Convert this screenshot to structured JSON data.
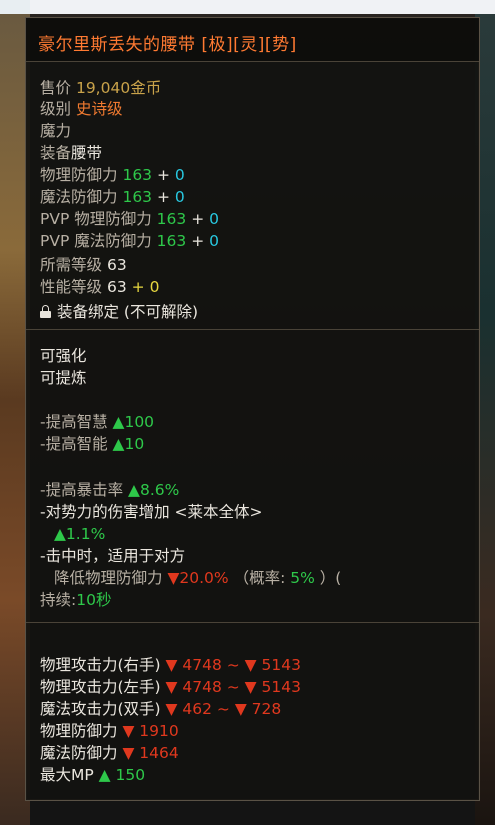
{
  "item": {
    "name": "豪尔里斯丢失的腰带 [极][灵][势]",
    "price_label": "售价",
    "price_value": "19,040金币",
    "grade_label": "级别",
    "grade_value": "史诗级",
    "type_label": "魔力",
    "equip_label": "装备",
    "equip_value": "腰带",
    "stats": [
      {
        "label": "物理防御力",
        "base": "163",
        "plus": "+",
        "bonus": "0"
      },
      {
        "label": "魔法防御力",
        "base": "163",
        "plus": "+",
        "bonus": "0"
      },
      {
        "label": "PVP 物理防御力",
        "base": "163",
        "plus": "+",
        "bonus": "0"
      },
      {
        "label": "PVP 魔法防御力",
        "base": "163",
        "plus": "+",
        "bonus": "0"
      }
    ],
    "req_level_label": "所需等级",
    "req_level_value": "63",
    "perf_level_label": "性能等级",
    "perf_level_value": "63",
    "perf_level_plus": "+",
    "perf_level_bonus": "0",
    "bind_text": "装备绑定 (不可解除)"
  },
  "flags": [
    "可强化",
    "可提炼"
  ],
  "bonuses": {
    "wisdom_label": "-提高智慧",
    "wisdom_value": "▲100",
    "intel_label": "-提高智能",
    "intel_value": "▲10",
    "crit_label": "-提高暴击率",
    "crit_value": "▲8.6%",
    "faction_label": "-对势力的伤害增加",
    "faction_target": "<莱本全体>",
    "faction_value": "▲1.1%",
    "onhit_label": "-击中时，适用于对方",
    "onhit_effect_label": "降低物理防御力",
    "onhit_effect_value": "▼20.0%",
    "onhit_chance_open": "（概率:",
    "onhit_chance_value": "5%",
    "onhit_chance_close": "）(",
    "duration_label": "持续:",
    "duration_value": "10秒"
  },
  "compare": [
    {
      "label": "物理攻击力(右手)",
      "value": "▼ 4748 ~ ▼ 5143",
      "color": "#e0381e"
    },
    {
      "label": "物理攻击力(左手)",
      "value": "▼ 4748 ~ ▼ 5143",
      "color": "#e0381e"
    },
    {
      "label": "魔法攻击力(双手)",
      "value": "▼ 462 ~ ▼ 728",
      "color": "#e0381e"
    },
    {
      "label": "物理防御力",
      "value": "▼ 1910",
      "color": "#e0381e"
    },
    {
      "label": "魔法防御力",
      "value": "▼ 1464",
      "color": "#e0381e"
    },
    {
      "label": "最大MP",
      "value": "▲ 150",
      "color": "#2ec84a"
    }
  ],
  "colors": {
    "title": "#ff7a32",
    "gold": "#c8a24a",
    "green": "#2ec84a",
    "cyan": "#28c8e0",
    "yellow": "#e8d840",
    "red": "#e0381e"
  }
}
